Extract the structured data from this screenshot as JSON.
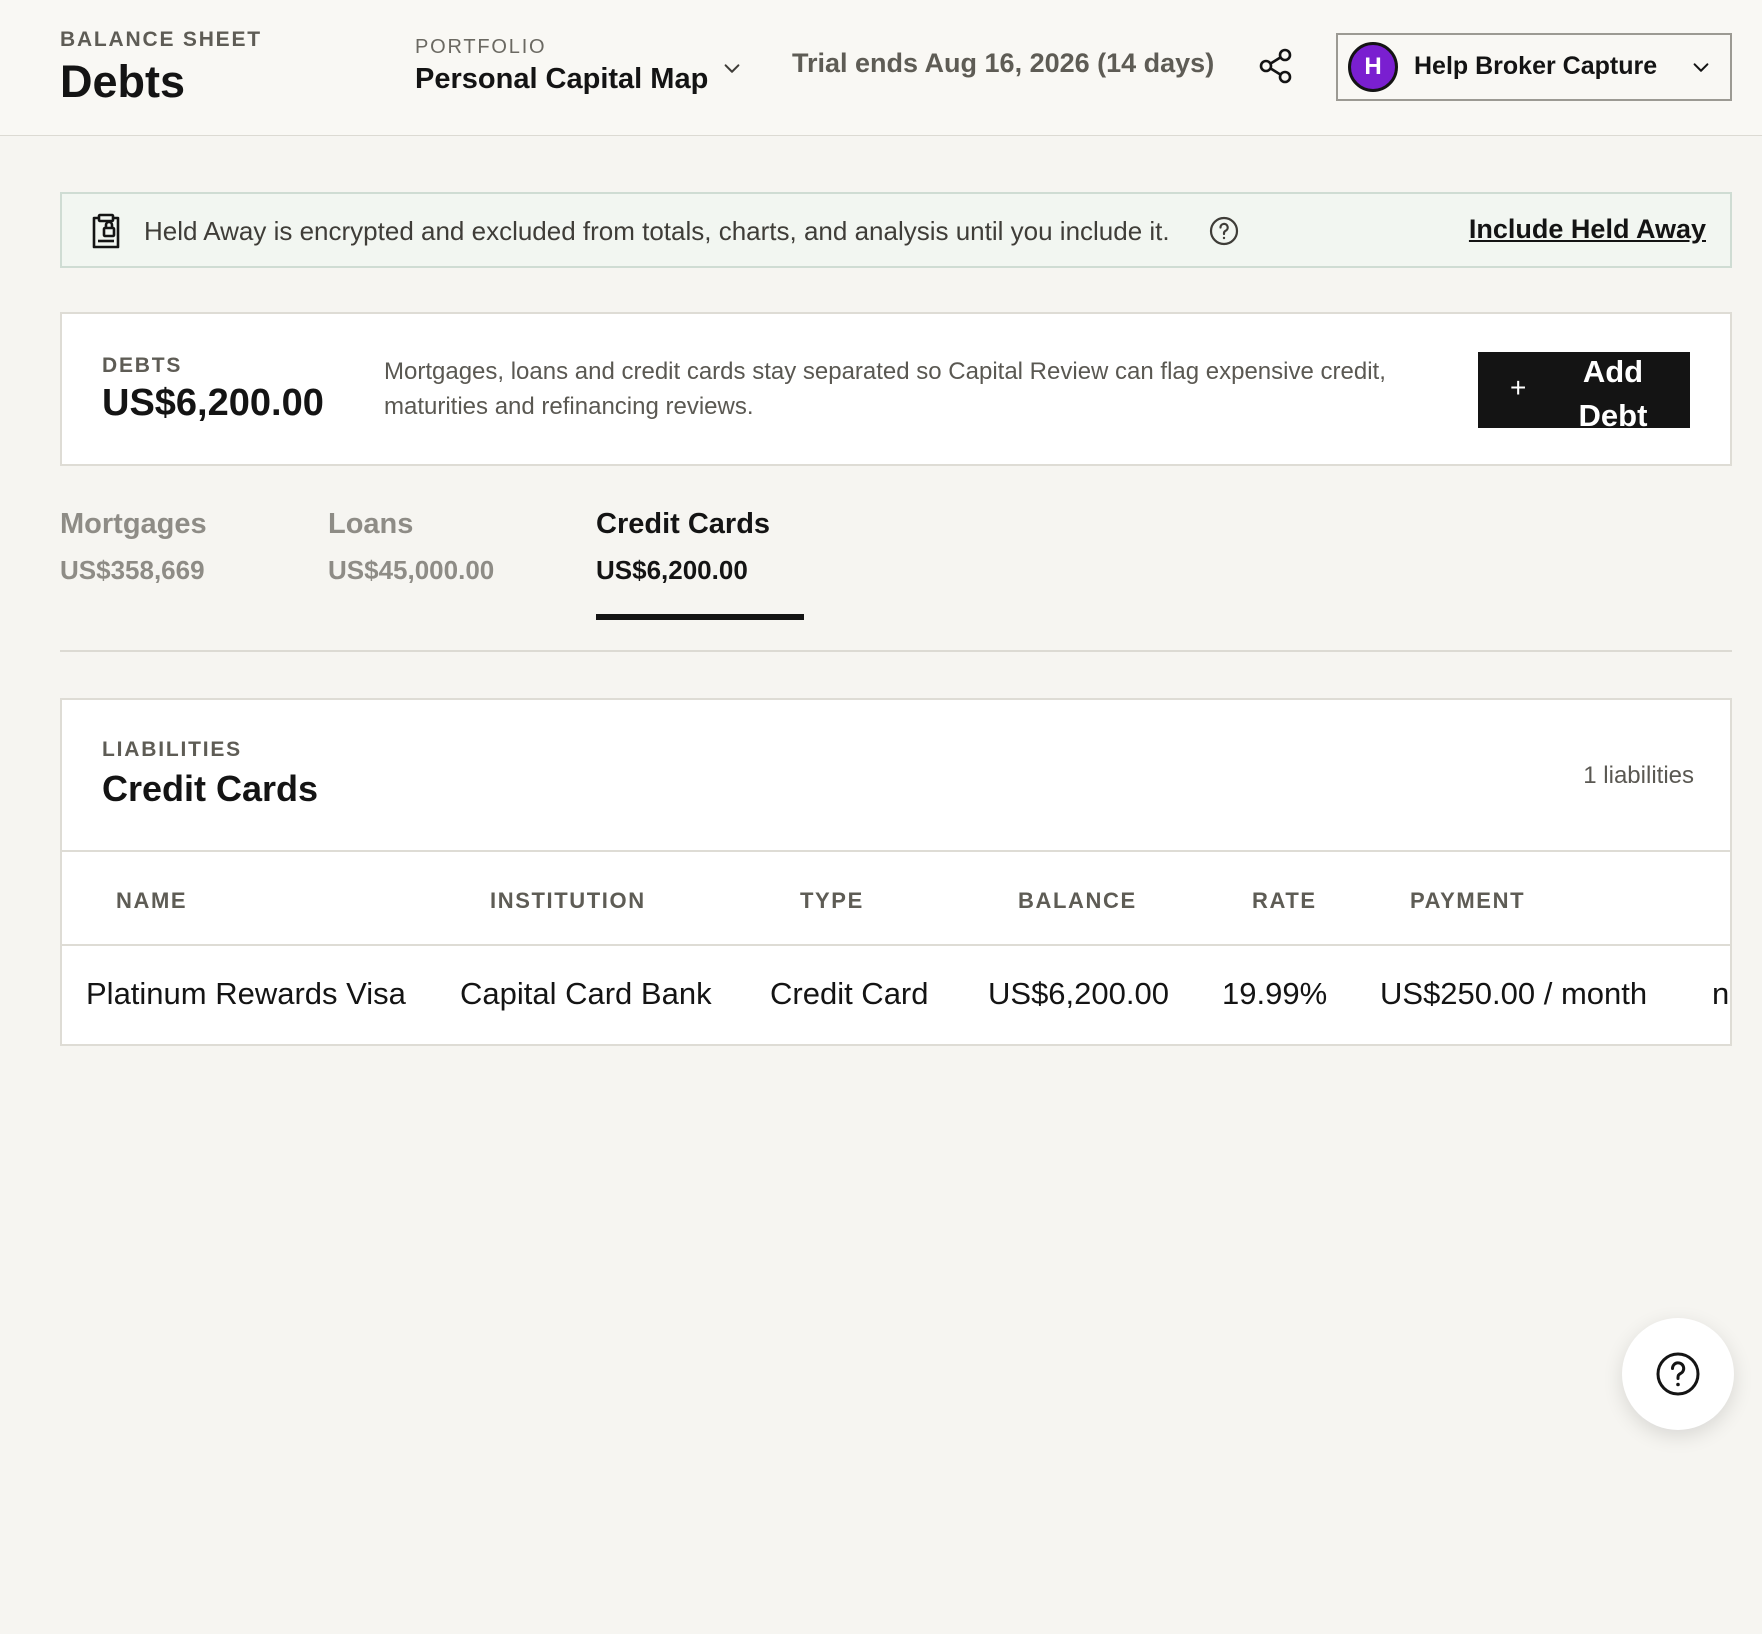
{
  "header": {
    "eyebrow": "BALANCE SHEET",
    "title": "Debts",
    "portfolio_label": "PORTFOLIO",
    "portfolio_name": "Personal Capital Map",
    "trial": "Trial ends Aug 16, 2026 (14 days)",
    "account_initial": "H",
    "account_name": "Help Broker Capture",
    "avatar_color": "#7a1fd0"
  },
  "banner": {
    "text": "Held Away is encrypted and excluded from totals, charts, and analysis until you include it.",
    "link": "Include Held Away"
  },
  "summary": {
    "eyebrow": "DEBTS",
    "amount": "US$6,200.00",
    "description": "Mortgages, loans and credit cards stay separated so Capital Review can flag expensive credit, maturities and refinancing reviews.",
    "button_plus": "+",
    "button_label": "Add Debt"
  },
  "tabs": [
    {
      "label": "Mortgages",
      "value": "US$358,669"
    },
    {
      "label": "Loans",
      "value": "US$45,000.00"
    },
    {
      "label": "Credit Cards",
      "value": "US$6,200.00"
    }
  ],
  "liabilities": {
    "eyebrow": "LIABILITIES",
    "title": "Credit Cards",
    "count": "1 liabilities",
    "columns": [
      "NAME",
      "INSTITUTION",
      "TYPE",
      "BALANCE",
      "RATE",
      "PAYMENT"
    ],
    "rows": [
      [
        "Platinum Rewards Visa",
        "Capital Card Bank",
        "Credit Card",
        "US$6,200.00",
        "19.99%",
        "US$250.00 / month",
        "n"
      ]
    ]
  },
  "icons": {
    "portfolio_chevron": "chevron-down-icon",
    "share": "share-icon",
    "account_chevron": "chevron-down-icon",
    "banner": "clipboard-lock-icon",
    "banner_help": "help-circle-icon",
    "floating_help": "help-circle-icon"
  }
}
